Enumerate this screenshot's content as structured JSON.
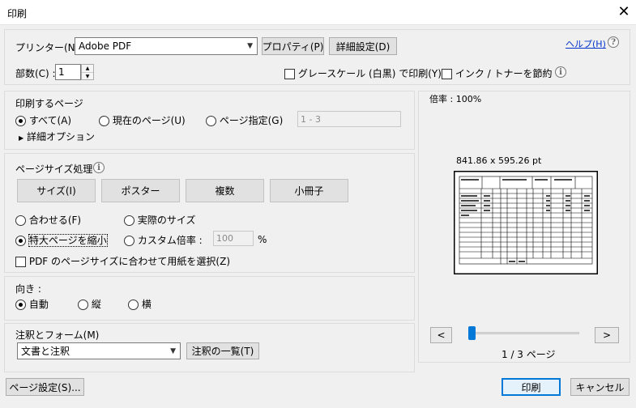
{
  "window": {
    "title": "印刷",
    "close_glyph": "✕"
  },
  "printer": {
    "label": "プリンター(N) :",
    "selected": "Adobe PDF",
    "properties_button": "プロパティ(P)",
    "advanced_button": "詳細設定(D)",
    "help_link": "ヘルプ(H)",
    "help_icon": "?"
  },
  "copies": {
    "label": "部数(C) :",
    "value": "1",
    "grayscale_label": "グレースケール (白黒) で印刷(Y)",
    "save_ink_label": "インク / トナーを節約",
    "info_icon": "i"
  },
  "pages": {
    "heading": "印刷するページ",
    "all_label": "すべて(A)",
    "current_label": "現在のページ(U)",
    "range_label": "ページ指定(G)",
    "range_value": "1 - 3",
    "more_options_label": "詳細オプション",
    "more_options_glyph": "▶",
    "selected": "all"
  },
  "page_sizing": {
    "heading": "ページサイズ処理",
    "info_icon": "i",
    "buttons": [
      "サイズ(I)",
      "ポスター",
      "複数",
      "小冊子"
    ],
    "fit_label": "合わせる(F)",
    "actual_label": "実際のサイズ",
    "shrink_label": "特大ページを縮小",
    "custom_label": "カスタム倍率 :",
    "custom_value": "100",
    "percent": "%",
    "selected": "shrink",
    "choose_paper_label": "PDF のページサイズに合わせて用紙を選択(Z)"
  },
  "orientation": {
    "heading": "向き :",
    "auto_label": "自動",
    "portrait_label": "縦",
    "landscape_label": "横",
    "selected": "auto"
  },
  "comments": {
    "heading": "注釈とフォーム(M)",
    "selected": "文書と注釈",
    "summary_button": "注釈の一覧(T)"
  },
  "preview": {
    "scale_label": "倍率 : 100%",
    "dimensions": "841.86 x 595.26 pt",
    "prev_button": "<",
    "next_button": ">",
    "page_indicator": "1 / 3 ページ",
    "slider_fraction": 0
  },
  "footer": {
    "page_setup_button": "ページ設定(S)...",
    "print_button": "印刷",
    "cancel_button": "キャンセル"
  },
  "colors": {
    "accent": "#0078d7",
    "link": "#0033cc"
  }
}
